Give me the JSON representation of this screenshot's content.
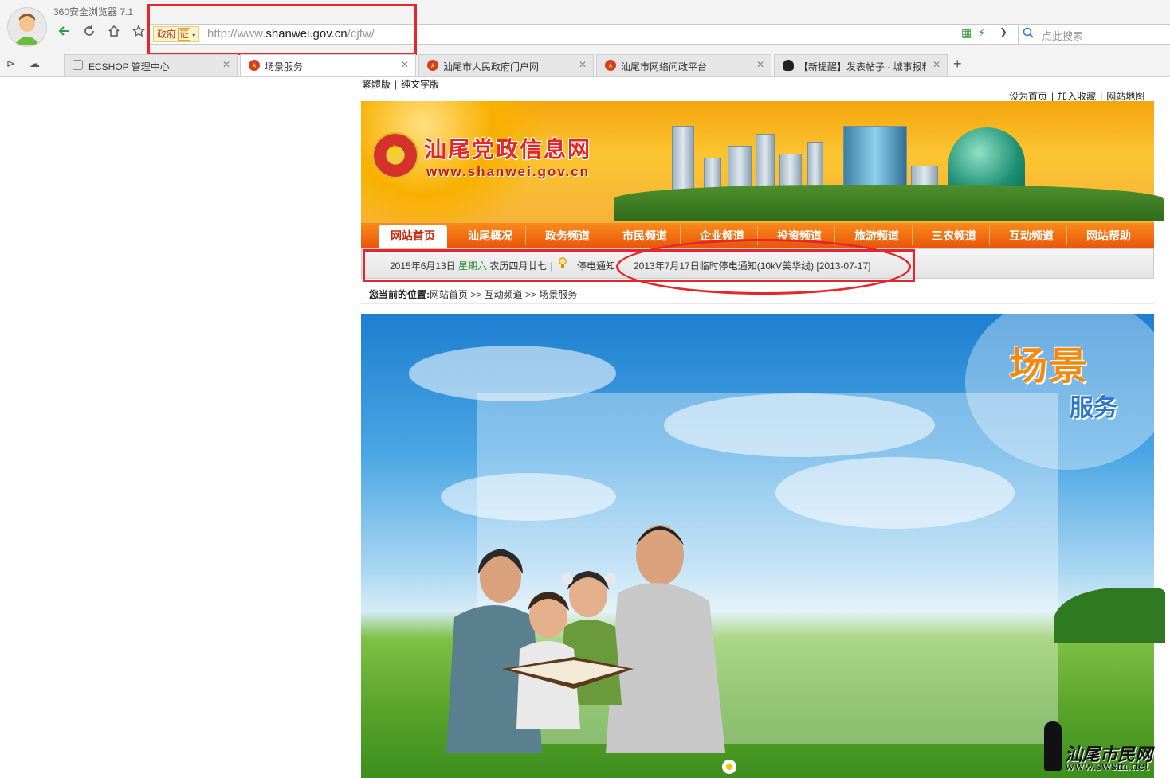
{
  "browser": {
    "title": "360安全浏览器 7.1",
    "gov_badge": "政府",
    "gov_badge_cert": "证",
    "url_prefix": "http://www.",
    "url_domain": "shanwei.gov.cn",
    "url_path": "/cjfw/",
    "search_placeholder": "点此搜索",
    "tabs": [
      {
        "label": "ECSHOP 管理中心",
        "active": false
      },
      {
        "label": "场景服务",
        "active": true
      },
      {
        "label": "汕尾市人民政府门户网",
        "active": false
      },
      {
        "label": "汕尾市网络问政平台",
        "active": false
      },
      {
        "label": "【新提醒】发表帖子 - 城事报料",
        "active": false
      }
    ]
  },
  "page": {
    "traditional_link": "繁體版",
    "text_only_link": "纯文字版",
    "top_links": [
      "设为首页",
      "加入收藏",
      "网站地图"
    ],
    "site_title": "汕尾党政信息网",
    "site_url": "www.shanwei.gov.cn",
    "nav": [
      "网站首页",
      "汕尾概况",
      "政务频道",
      "市民频道",
      "企业频道",
      "投资频道",
      "旅游频道",
      "三农频道",
      "互动频道",
      "网站帮助"
    ],
    "date_prefix": "2015年6月13日",
    "weekday": "星期六",
    "lunar": "农历四月廿七",
    "notice_label": "停电通知",
    "notice_item": "2013年7月17日临时停电通知(10kV美华线) [2013-07-17]",
    "breadcrumb_label": "您当前的位置:",
    "breadcrumb": "网站首页 >> 互动频道 >> 场景服务",
    "hero_title_1": "场景",
    "hero_title_2": "服务",
    "watermark_text": "汕尾市民网",
    "watermark_url": "www.swsm.net"
  },
  "colors": {
    "annotation": "#e5262b",
    "nav_bg": "#e9550b",
    "accent_green": "#1f8e2d"
  }
}
